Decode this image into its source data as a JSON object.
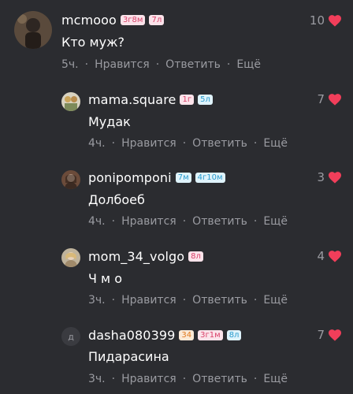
{
  "colors": {
    "background": "#2b2c30",
    "heart": "#f13e5a",
    "meta_text": "#9a9ba1"
  },
  "comments": [
    {
      "username": "mcmooo",
      "badges": [
        "3г8м",
        "7л"
      ],
      "text": "Кто муж?",
      "time": "5ч.",
      "like_label": "Нравится",
      "reply_label": "Ответить",
      "more_label": "Ещё",
      "likes": "10"
    },
    {
      "username": "mama.square",
      "badges": [
        "1г",
        "5л"
      ],
      "text": "Мудак",
      "time": "4ч.",
      "like_label": "Нравится",
      "reply_label": "Ответить",
      "more_label": "Ещё",
      "likes": "7"
    },
    {
      "username": "ponipomponi",
      "badges": [
        "7м",
        "4г10м"
      ],
      "text": "Долбоеб",
      "time": "4ч.",
      "like_label": "Нравится",
      "reply_label": "Ответить",
      "more_label": "Ещё",
      "likes": "3"
    },
    {
      "username": "mom_34_volgo",
      "badges": [
        "8л"
      ],
      "text": "Ч м о",
      "time": "3ч.",
      "like_label": "Нравится",
      "reply_label": "Ответить",
      "more_label": "Ещё",
      "likes": "4"
    },
    {
      "username": "dasha080399",
      "avatar_letter": "д",
      "badges": [
        "34",
        "3г1м",
        "8л"
      ],
      "text": "Пидарасина",
      "time": "3ч.",
      "like_label": "Нравится",
      "reply_label": "Ответить",
      "more_label": "Ещё",
      "likes": "7"
    }
  ]
}
